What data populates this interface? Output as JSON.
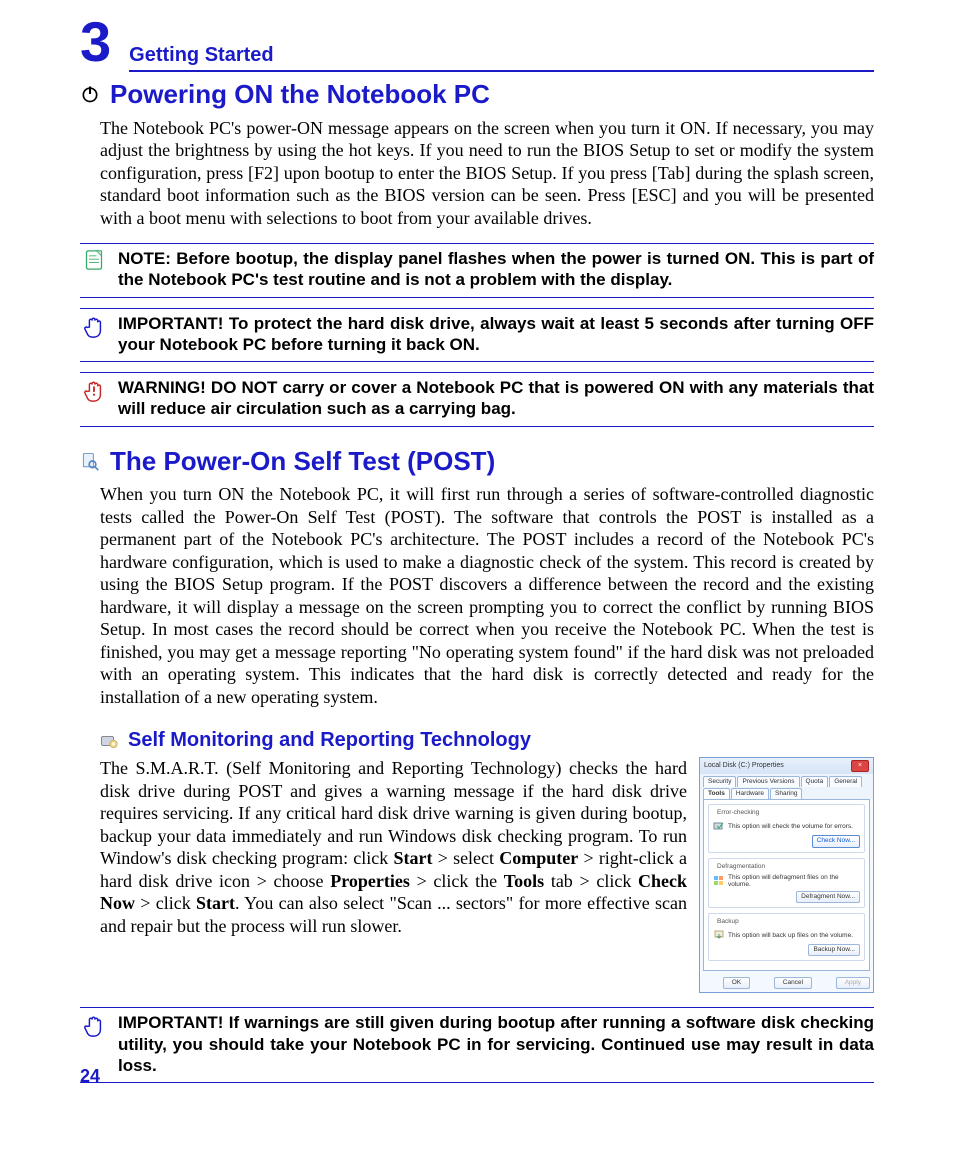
{
  "chapter": {
    "number": "3",
    "title": "Getting Started"
  },
  "section1": {
    "heading": "Powering ON the Notebook PC",
    "body": "The Notebook PC's power-ON message appears on the screen when you turn it ON. If necessary, you may adjust the brightness by using the hot keys. If you need to run the BIOS Setup to set or modify the system configuration, press [F2] upon bootup to enter the BIOS Setup. If you press [Tab] during the splash screen, standard boot information such as the BIOS version can be seen. Press [ESC] and you will be presented with a boot menu with selections to boot from your available drives."
  },
  "callouts": {
    "note": "NOTE:  Before bootup, the display panel flashes when the power is turned ON. This is part of the Notebook PC's test routine and is not a problem with the display.",
    "important1": "IMPORTANT!  To protect the hard disk drive, always wait at least 5 seconds after turning OFF your Notebook PC before turning it back ON.",
    "warning": "WARNING! DO NOT carry or cover a Notebook PC that is powered ON with any materials that will reduce air circulation such as a carrying bag.",
    "important2": "IMPORTANT! If warnings are still given during bootup after running a software disk checking utility, you should take your Notebook PC in for servicing. Continued use may result in data loss."
  },
  "section2": {
    "heading": "The Power-On Self Test (POST)",
    "body": "When you turn ON the Notebook PC, it will first run through a series of software-controlled diagnostic tests called the Power-On Self Test (POST). The software that controls the POST is installed as a permanent part of the Notebook PC's architecture. The POST includes a record of the Notebook PC's hardware configuration, which is used to make a diagnostic check of the system. This record is created by using the BIOS Setup program. If the POST discovers a difference between the record and the existing hardware, it will display a message on the screen prompting you to correct the conflict by running BIOS Setup. In most cases the record should be correct when you receive the Notebook PC. When the test is finished, you may get a message reporting \"No operating system found\" if the hard disk was not preloaded with an operating system. This indicates that the hard disk is correctly detected and ready for the installation of a new operating system."
  },
  "section3": {
    "heading": "Self Monitoring and Reporting Technology",
    "seg": {
      "p1": "The S.M.A.R.T. (Self Monitoring and Reporting Technology) checks the hard disk drive during POST and gives a warning message if the hard disk drive requires servicing. If any critical hard disk drive warning is given during bootup, backup your data immediately and run Windows disk checking program. To run Window's disk checking program: click ",
      "b1": "Start",
      "p2": " > select ",
      "b2": "Computer",
      "p3": " > right-click a hard disk drive icon > choose ",
      "b3": "Properties",
      "p4": " > click the ",
      "b4": "Tools",
      "p5": " tab > click ",
      "b5": "Check Now",
      "p6": " > click ",
      "b6": "Start",
      "p7": ". You can also select \"Scan ... sectors\" for more effective scan and repair but the process will run slower."
    }
  },
  "props": {
    "title": "Local Disk (C:) Properties",
    "tabs": [
      "Security",
      "Previous Versions",
      "Quota",
      "General",
      "Tools",
      "Hardware",
      "Sharing"
    ],
    "active_tab": "Tools",
    "groups": {
      "errcheck": {
        "title": "Error-checking",
        "text": "This option will check the volume for errors.",
        "button": "Check Now..."
      },
      "defrag": {
        "title": "Defragmentation",
        "text": "This option will defragment files on the volume.",
        "button": "Defragment Now..."
      },
      "backup": {
        "title": "Backup",
        "text": "This option will back up files on the volume.",
        "button": "Backup Now..."
      }
    },
    "footer": {
      "ok": "OK",
      "cancel": "Cancel",
      "apply": "Apply"
    }
  },
  "page_number": "24"
}
